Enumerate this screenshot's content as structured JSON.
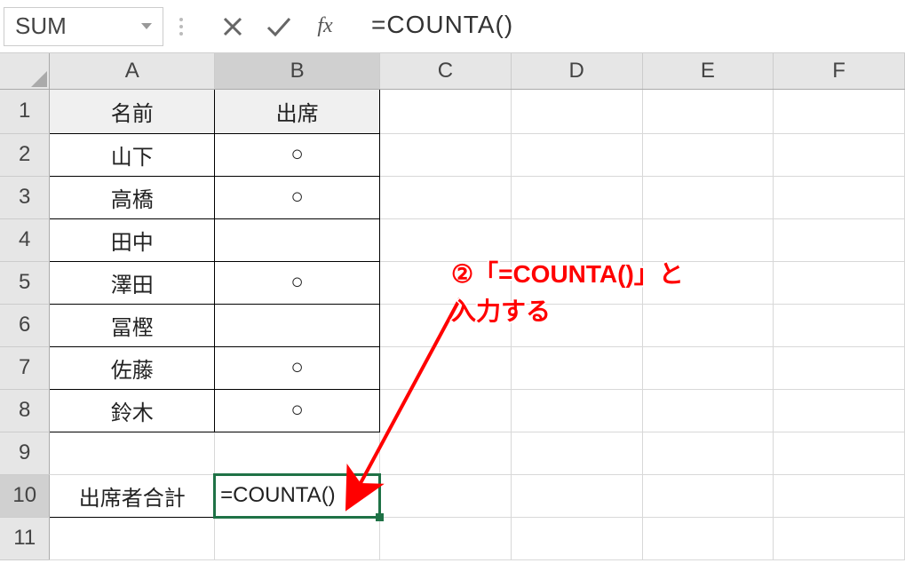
{
  "nameBox": "SUM",
  "formula": "=COUNTA()",
  "columns": [
    "A",
    "B",
    "C",
    "D",
    "E",
    "F"
  ],
  "rows": [
    "1",
    "2",
    "3",
    "4",
    "5",
    "6",
    "7",
    "8",
    "9",
    "10",
    "11"
  ],
  "activeCol": "B",
  "activeRow": "10",
  "tableHeader": {
    "A": "名前",
    "B": "出席"
  },
  "dataRows": [
    {
      "name": "山下",
      "mark": "○"
    },
    {
      "name": "高橋",
      "mark": "○"
    },
    {
      "name": "田中",
      "mark": ""
    },
    {
      "name": "澤田",
      "mark": "○"
    },
    {
      "name": "冨樫",
      "mark": ""
    },
    {
      "name": "佐藤",
      "mark": "○"
    },
    {
      "name": "鈴木",
      "mark": "○"
    }
  ],
  "totalLabel": "出席者合計",
  "activeCellValue": "=COUNTA()",
  "annotation": {
    "line1": "②「=COUNTA()」と",
    "line2": "入力する"
  }
}
